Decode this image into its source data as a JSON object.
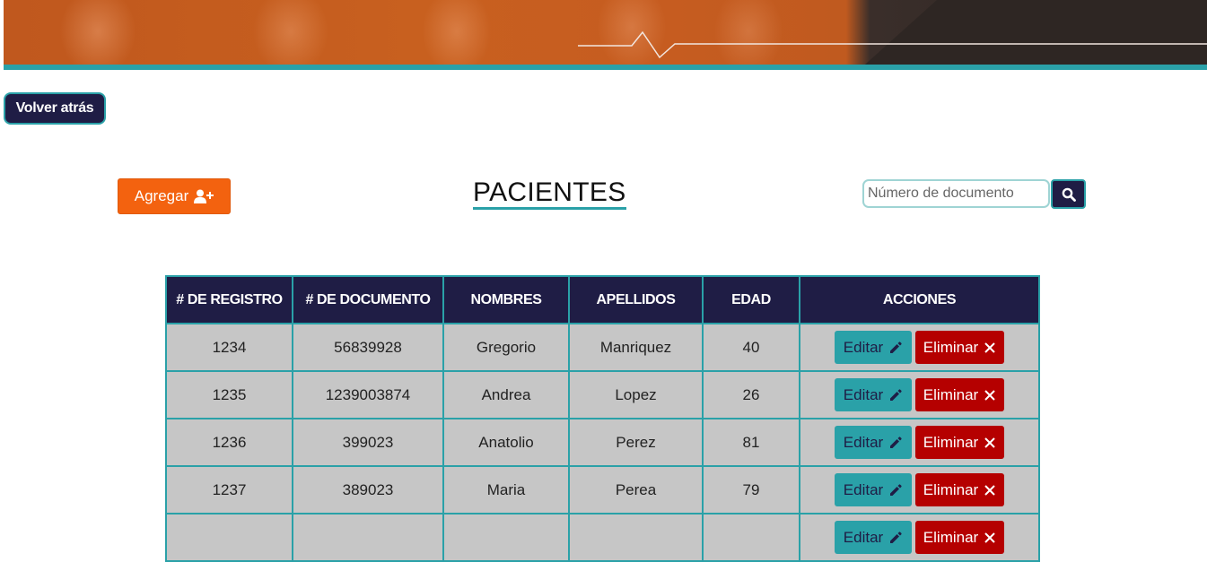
{
  "header": {
    "back_label": "Volver atrás"
  },
  "toolbar": {
    "add_label": "Agregar",
    "title": "PACIENTES",
    "search_placeholder": "Número de documento"
  },
  "icons": {
    "add": "user-plus-icon",
    "search": "magnifier-icon",
    "edit": "pencil-icon",
    "delete": "x-icon"
  },
  "colors": {
    "navy": "#1f1d45",
    "teal": "#2aa1a8",
    "orange": "#f3620f",
    "red": "#b50000",
    "row_bg": "#c6c6c6"
  },
  "table": {
    "headers": [
      "# DE REGISTRO",
      "# DE DOCUMENTO",
      "NOMBRES",
      "APELLIDOS",
      "EDAD",
      "ACCIONES"
    ],
    "edit_label": "Editar",
    "delete_label": "Eliminar",
    "rows": [
      {
        "registro": "1234",
        "documento": "56839928",
        "nombres": "Gregorio",
        "apellidos": "Manriquez",
        "edad": "40"
      },
      {
        "registro": "1235",
        "documento": "1239003874",
        "nombres": "Andrea",
        "apellidos": "Lopez",
        "edad": "26"
      },
      {
        "registro": "1236",
        "documento": "399023",
        "nombres": "Anatolio",
        "apellidos": "Perez",
        "edad": "81"
      },
      {
        "registro": "1237",
        "documento": "389023",
        "nombres": "Maria",
        "apellidos": "Perea",
        "edad": "79"
      },
      {
        "registro": "",
        "documento": "",
        "nombres": "",
        "apellidos": "",
        "edad": ""
      }
    ]
  }
}
